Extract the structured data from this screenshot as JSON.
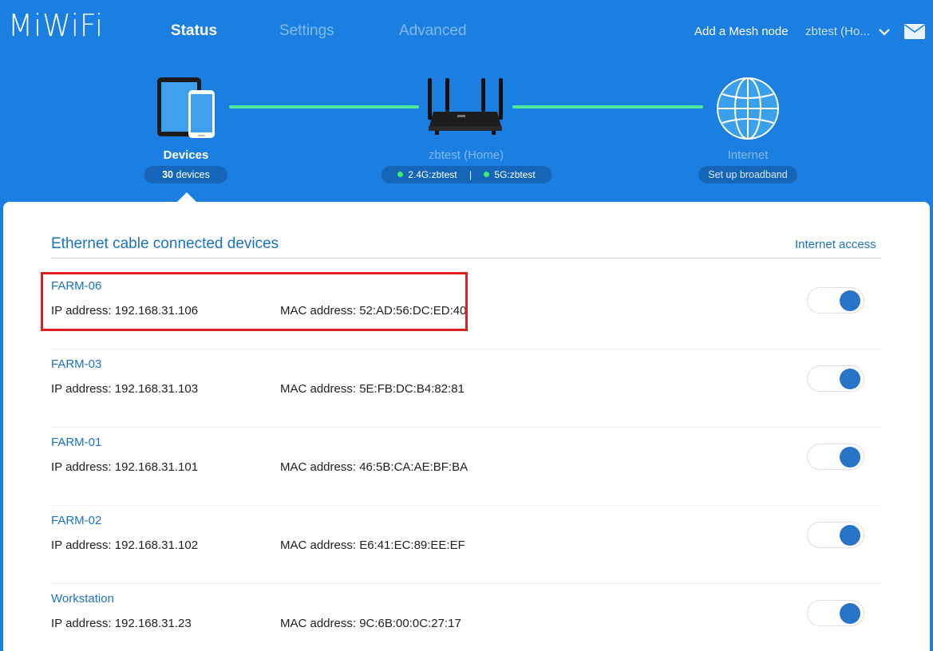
{
  "header": {
    "logo": "MiWiFi",
    "tabs": [
      {
        "label": "Status",
        "active": true
      },
      {
        "label": "Settings",
        "active": false
      },
      {
        "label": "Advanced",
        "active": false
      }
    ],
    "add_mesh_label": "Add a Mesh node",
    "account_label": "zbtest (Ho...",
    "chevron_icon": "chevron-down-icon",
    "mail_icon": "mail-icon"
  },
  "topology": {
    "devices": {
      "label": "Devices",
      "count": "30",
      "count_suffix": "devices",
      "icon": "devices-icon"
    },
    "router": {
      "label": "zbtest (Home)",
      "band1": "2.4G:zbtest",
      "band2": "5G:zbtest",
      "separator": "|",
      "icon": "router-icon"
    },
    "internet": {
      "label": "Internet",
      "action": "Set up broadband",
      "icon": "globe-icon"
    }
  },
  "section": {
    "title": "Ethernet cable connected devices",
    "action": "Internet access"
  },
  "devices": [
    {
      "name": "FARM-06",
      "ip": "IP address: 192.168.31.106",
      "mac": "MAC address: 52:AD:56:DC:ED:40",
      "internet_access": true,
      "highlighted": true
    },
    {
      "name": "FARM-03",
      "ip": "IP address: 192.168.31.103",
      "mac": "MAC address: 5E:FB:DC:B4:82:81",
      "internet_access": true,
      "highlighted": false
    },
    {
      "name": "FARM-01",
      "ip": "IP address: 192.168.31.101",
      "mac": "MAC address: 46:5B:CA:AE:BF:BA",
      "internet_access": true,
      "highlighted": false
    },
    {
      "name": "FARM-02",
      "ip": "IP address: 192.168.31.102",
      "mac": "MAC address: E6:41:EC:89:EE:EF",
      "internet_access": true,
      "highlighted": false
    },
    {
      "name": "Workstation",
      "ip": "IP address: 192.168.31.23",
      "mac": "MAC address: 9C:6B:00:0C:27:17",
      "internet_access": true,
      "highlighted": false
    }
  ],
  "colors": {
    "header_bg": "#1a7fe0",
    "link_line": "#4de89a",
    "accent": "#1a72c4",
    "toggle_on": "#2a74c8",
    "highlight": "#e02020"
  }
}
